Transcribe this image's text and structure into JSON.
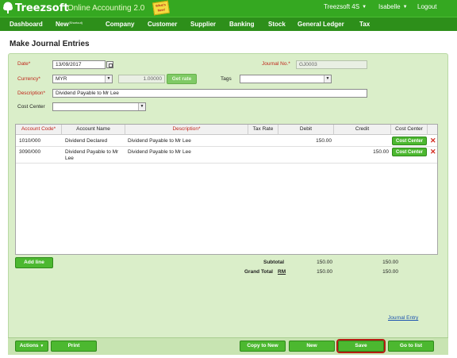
{
  "app": {
    "logo": "Treezsoft",
    "subtitle": "Online Accounting 2.0",
    "whatsnew": "What's New!",
    "company": "Treezsoft 4S",
    "user": "Isabelle",
    "logout": "Logout"
  },
  "menu": {
    "dashboard": "Dashboard",
    "new": "New",
    "new_sup": "(Shortcut)",
    "company": "Company",
    "customer": "Customer",
    "supplier": "Supplier",
    "banking": "Banking",
    "stock": "Stock",
    "general_ledger": "General Ledger",
    "tax": "Tax"
  },
  "page": {
    "title": "Make Journal Entries"
  },
  "form": {
    "date_label": "Date*",
    "date_value": "13/09/2017",
    "journal_no_label": "Journal No.*",
    "journal_no_value": "GJ0003",
    "currency_label": "Currency*",
    "currency_value": "MYR",
    "rate_value": "1.00000",
    "get_rate": "Get rate",
    "tags_label": "Tags",
    "tags_value": "",
    "description_label": "Description*",
    "description_value": "Dividend Payable to Mr Lee",
    "cost_center_label": "Cost Center",
    "cost_center_value": ""
  },
  "table": {
    "headers": {
      "account_code": "Account Code*",
      "account_name": "Account Name",
      "description": "Description*",
      "tax_rate": "Tax Rate",
      "debit": "Debit",
      "credit": "Credit",
      "cost_center": "Cost Center"
    },
    "rows": [
      {
        "code": "1010/000",
        "name": "Dividend Declared",
        "description": "Dividend Payable to Mr Lee",
        "tax_rate": "",
        "debit": "150.00",
        "credit": "",
        "cc_button": "Cost Center"
      },
      {
        "code": "3090/000",
        "name": "Dividend Payable to Mr Lee",
        "description": "Dividend Payable to Mr Lee",
        "tax_rate": "",
        "debit": "",
        "credit": "150.00",
        "cc_button": "Cost Center"
      }
    ]
  },
  "add_line": "Add line",
  "totals": {
    "subtotal_label": "Subtotal",
    "subtotal_debit": "150.00",
    "subtotal_credit": "150.00",
    "grand_total_label": "Grand Total",
    "grand_total_currency": "RM",
    "grand_total_debit": "150.00",
    "grand_total_credit": "150.00"
  },
  "journal_entry_link": "Journal Entry",
  "bottom": {
    "actions": "Actions",
    "print": "Print",
    "copy_to_new": "Copy to New",
    "new": "New",
    "save": "Save",
    "go_to_list": "Go to list"
  },
  "colors": {
    "brand_green": "#35a821",
    "menu_green": "#2d8f1a",
    "required_red": "#c0271b",
    "panel_bg": "#daeec9"
  }
}
